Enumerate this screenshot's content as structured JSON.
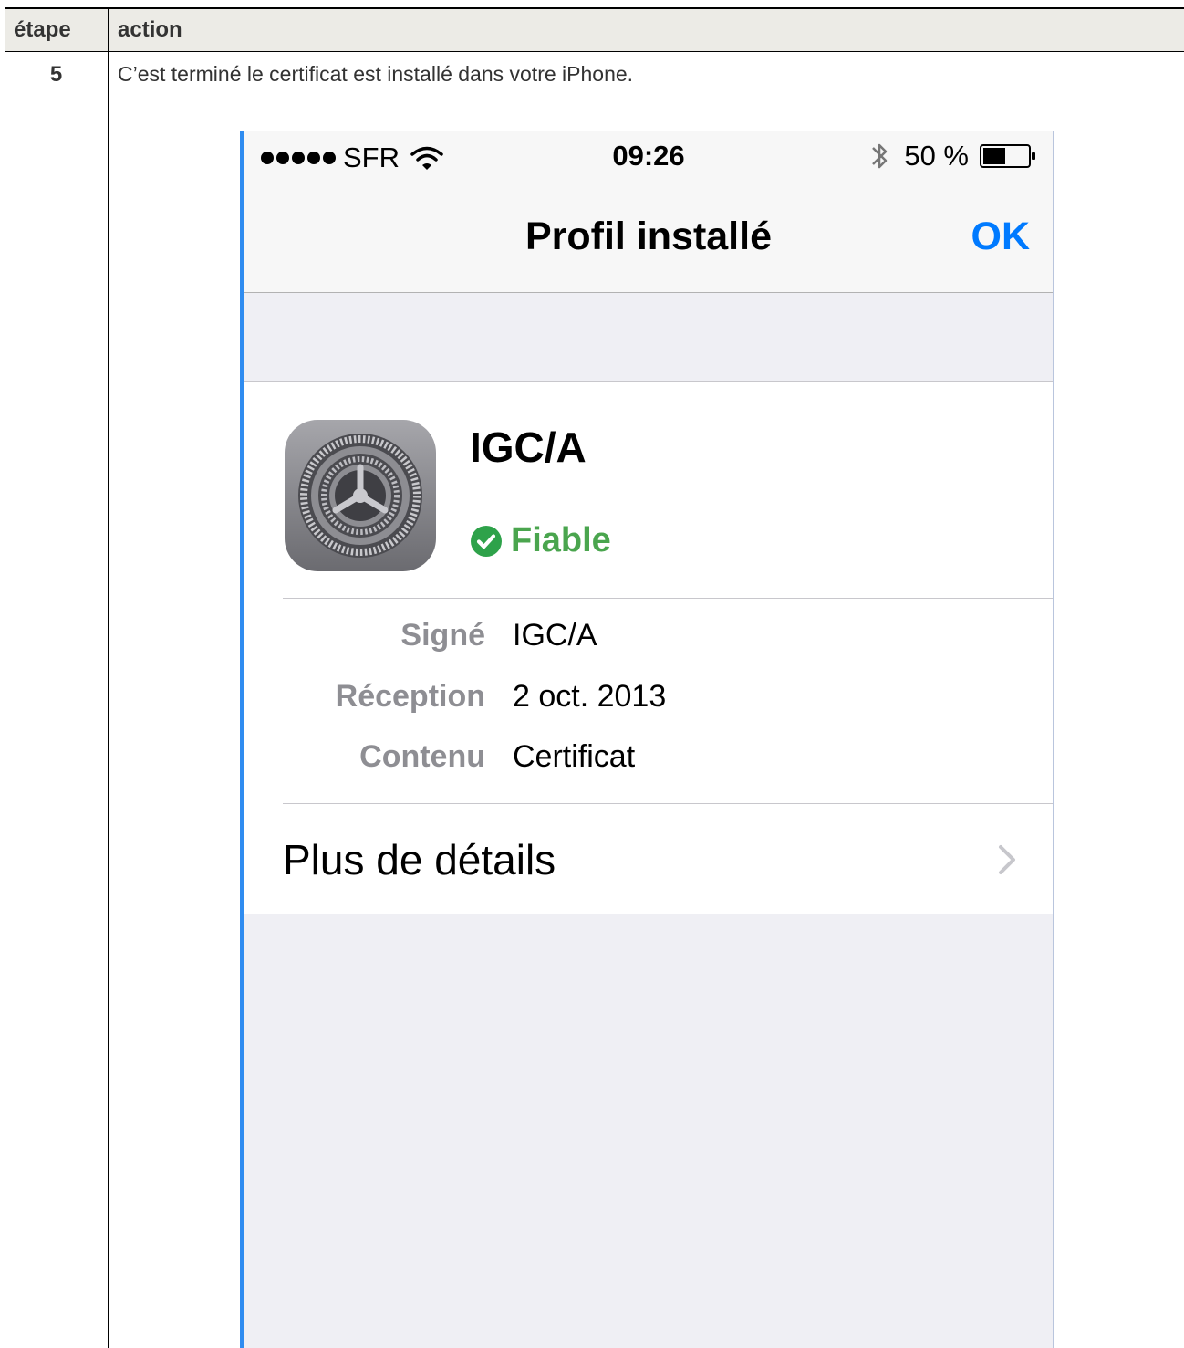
{
  "doc": {
    "header_step": "étape",
    "header_action": "action",
    "step_number": "5",
    "step_text": "C’est terminé le certificat est installé dans votre iPhone."
  },
  "phone": {
    "status_bar": {
      "carrier": "SFR",
      "time": "09:26",
      "battery_text": "50 %",
      "battery_level": 0.5
    },
    "nav": {
      "title": "Profil installé",
      "done_label": "OK"
    },
    "profile": {
      "name": "IGC/A",
      "trust_label": "Fiable",
      "icon": "settings-gear-icon",
      "details": [
        {
          "label": "Signé",
          "value": "IGC/A"
        },
        {
          "label": "Réception",
          "value": "2 oct. 2013"
        },
        {
          "label": "Contenu",
          "value": "Certificat"
        }
      ],
      "more_details_label": "Plus de détails"
    },
    "colors": {
      "accent_blue": "#007aff",
      "trust_green": "#4aa54e",
      "grouped_bg": "#efeff4"
    }
  }
}
